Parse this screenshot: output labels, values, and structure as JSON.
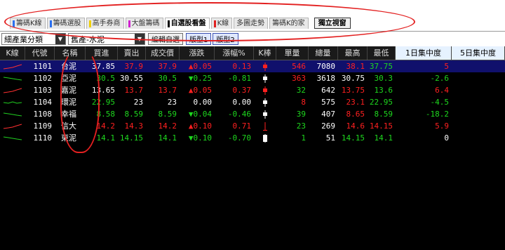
{
  "tabs": [
    {
      "label": "籌碼K線",
      "color": "#2a6ff0",
      "active": false
    },
    {
      "label": "籌碼選股",
      "color": "#2a6ff0",
      "active": false
    },
    {
      "label": "高手券商",
      "color": "#f0d000",
      "active": false
    },
    {
      "label": "大盤籌碼",
      "color": "#d020d0",
      "active": false
    },
    {
      "label": "自選股看盤",
      "color": "#000000",
      "active": true
    },
    {
      "label": "K線",
      "color": "#e02020",
      "active": false
    },
    {
      "label": "多圖走勢",
      "color": "",
      "active": false
    },
    {
      "label": "籌碼K的家",
      "color": "",
      "active": false
    }
  ],
  "standalone_label": "獨立視窗",
  "toolbar": {
    "category_select": "細產業分類",
    "group_select": "舊產-水泥",
    "edit_label": "編輯自選",
    "layout1_label": "版型1",
    "layout2_label": "版型2"
  },
  "table": {
    "headers": [
      "K線",
      "代號",
      "名稱",
      "買進",
      "賣出",
      "成交價",
      "漲跌",
      "漲幅%",
      "K棒",
      "單量",
      "總量",
      "最高",
      "最低",
      "1日集中度",
      "5日集中度"
    ],
    "rows": [
      {
        "code": "1101",
        "name": "台泥",
        "buy": "37.85",
        "sell": "37.9",
        "price": "37.9",
        "dir": "up",
        "chg": "0.05",
        "pct": "0.13",
        "unit": "546",
        "vol": "7080",
        "high": "38.1",
        "low": "37.75",
        "c1": "5",
        "c5": "",
        "colors": {
          "buy": "white",
          "sell": "red",
          "price": "red",
          "chg": "red",
          "pct": "red",
          "unit": "red",
          "high": "red",
          "low": "green",
          "c1": "red"
        }
      },
      {
        "code": "1102",
        "name": "亞泥",
        "buy": "30.5",
        "sell": "30.55",
        "price": "30.5",
        "dir": "down",
        "chg": "0.25",
        "pct": "-0.81",
        "unit": "363",
        "vol": "3618",
        "high": "30.75",
        "low": "30.3",
        "c1": "-2.6",
        "c5": "",
        "colors": {
          "buy": "green",
          "sell": "white",
          "price": "green",
          "chg": "green",
          "pct": "green",
          "unit": "red",
          "high": "white",
          "low": "green",
          "c1": "green"
        }
      },
      {
        "code": "1103",
        "name": "嘉泥",
        "buy": "13.65",
        "sell": "13.7",
        "price": "13.7",
        "dir": "up",
        "chg": "0.05",
        "pct": "0.37",
        "unit": "32",
        "vol": "642",
        "high": "13.75",
        "low": "13.6",
        "c1": "6.4",
        "c5": "",
        "colors": {
          "buy": "white",
          "sell": "red",
          "price": "red",
          "chg": "red",
          "pct": "red",
          "unit": "green",
          "high": "red",
          "low": "green",
          "c1": "red"
        }
      },
      {
        "code": "1104",
        "name": "環泥",
        "buy": "22.95",
        "sell": "23",
        "price": "23",
        "dir": "flat",
        "chg": "0.00",
        "pct": "0.00",
        "unit": "8",
        "vol": "575",
        "high": "23.1",
        "low": "22.95",
        "c1": "-4.5",
        "c5": "",
        "colors": {
          "buy": "green",
          "sell": "white",
          "price": "white",
          "chg": "white",
          "pct": "white",
          "unit": "red",
          "high": "red",
          "low": "green",
          "c1": "green"
        }
      },
      {
        "code": "1108",
        "name": "幸福",
        "buy": "8.58",
        "sell": "8.59",
        "price": "8.59",
        "dir": "down",
        "chg": "0.04",
        "pct": "-0.46",
        "unit": "39",
        "vol": "407",
        "high": "8.65",
        "low": "8.59",
        "c1": "-18.2",
        "c5": "",
        "colors": {
          "buy": "green",
          "sell": "green",
          "price": "green",
          "chg": "green",
          "pct": "green",
          "unit": "green",
          "high": "red",
          "low": "green",
          "c1": "green"
        }
      },
      {
        "code": "1109",
        "name": "信大",
        "buy": "14.2",
        "sell": "14.3",
        "price": "14.2",
        "dir": "up",
        "chg": "0.10",
        "pct": "0.71",
        "unit": "23",
        "vol": "269",
        "high": "14.6",
        "low": "14.15",
        "c1": "5.9",
        "c5": "",
        "colors": {
          "buy": "red",
          "sell": "red",
          "price": "red",
          "chg": "red",
          "pct": "red",
          "unit": "green",
          "high": "red",
          "low": "red",
          "c1": "red"
        }
      },
      {
        "code": "1110",
        "name": "東泥",
        "buy": "14.1",
        "sell": "14.15",
        "price": "14.1",
        "dir": "down",
        "chg": "0.10",
        "pct": "-0.70",
        "unit": "1",
        "vol": "51",
        "high": "14.15",
        "low": "14.1",
        "c1": "0",
        "c5": "",
        "colors": {
          "buy": "green",
          "sell": "green",
          "price": "green",
          "chg": "green",
          "pct": "green",
          "unit": "green",
          "high": "green",
          "low": "green",
          "c1": "white"
        }
      }
    ]
  }
}
